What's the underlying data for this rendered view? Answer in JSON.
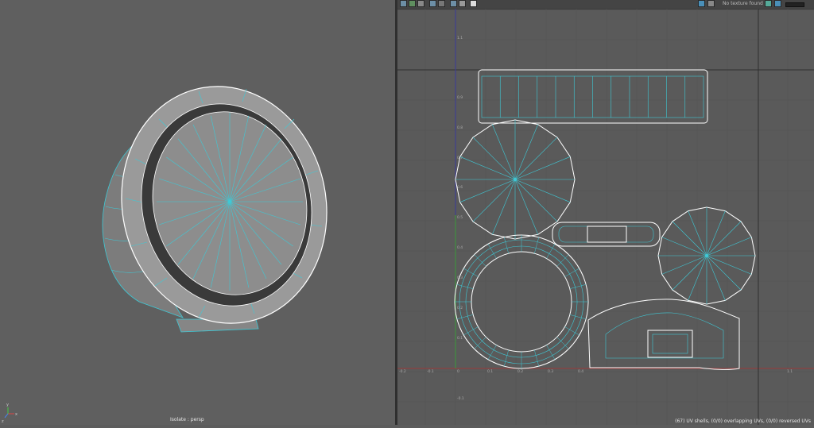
{
  "viewport": {
    "label": "Isolate : persp",
    "axis_labels": [
      "x",
      "y",
      "z"
    ]
  },
  "uv_editor": {
    "toolbar": {
      "texture_status": "No texture found"
    },
    "status_text": "(67) UV shells, (0/0) overlapping UVs, (0/0) reversed UVs",
    "axis_ticks": {
      "v_axis": [
        "1.1",
        "0.9",
        "0.8",
        "0.7",
        "0.6",
        "0.5",
        "0.4",
        "0.3",
        "0.2",
        "0.1",
        "-0.1"
      ],
      "u_axis": [
        "-0.2",
        "-0.1",
        "0",
        "0.1",
        "0.2",
        "0.3",
        "0.4",
        "1.1"
      ]
    }
  },
  "colors": {
    "background": "#5f5f5f",
    "wire_cyan": "#3ec9d6",
    "border_white": "#ffffff",
    "mesh_gray": "#8a8a8a"
  }
}
